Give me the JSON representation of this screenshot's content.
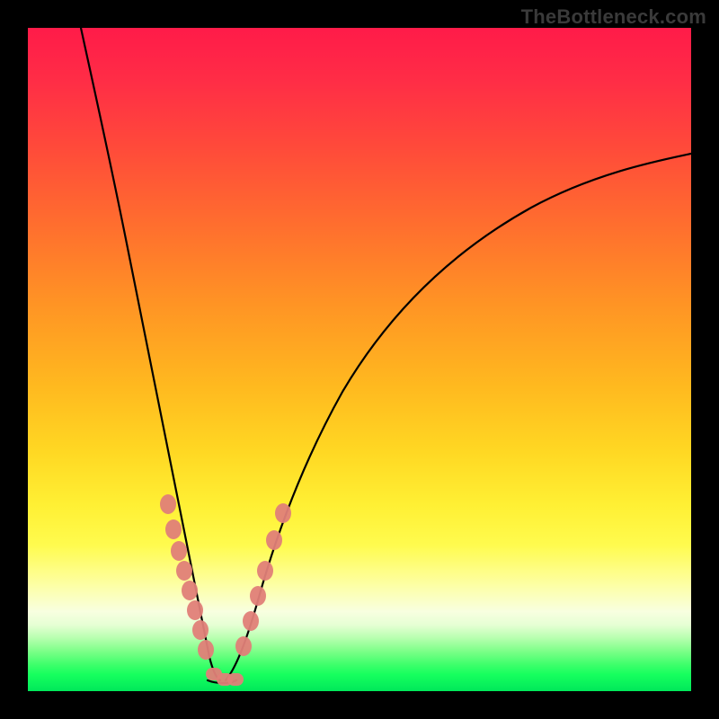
{
  "watermark": "TheBottleneck.com",
  "chart_data": {
    "type": "line",
    "title": "",
    "xlabel": "",
    "ylabel": "",
    "xlim": [
      0,
      100
    ],
    "ylim": [
      0,
      100
    ],
    "grid": false,
    "background_gradient": {
      "top": "#ff1b49",
      "bottom": "#00e85a",
      "description": "red→orange→yellow→green vertical gradient; green band at bottom ≈ 0–5%"
    },
    "series": [
      {
        "name": "left-curve",
        "description": "Left branch of V; steep descent from top-left toward trough",
        "x": [
          8,
          10,
          12,
          14,
          16,
          18,
          20,
          22,
          23,
          24,
          25,
          26,
          27,
          28
        ],
        "y": [
          100,
          90,
          79,
          67,
          55,
          44,
          33,
          22,
          17,
          12,
          8,
          5,
          3,
          2
        ]
      },
      {
        "name": "right-curve",
        "description": "Right branch of V; rises from trough, concave, tapering toward upper right",
        "x": [
          30,
          31,
          33,
          35,
          38,
          42,
          47,
          53,
          60,
          68,
          77,
          87,
          100
        ],
        "y": [
          2,
          4,
          9,
          16,
          25,
          36,
          47,
          56,
          63,
          69,
          74,
          78,
          81
        ]
      },
      {
        "name": "trough",
        "description": "Near-flat bottom of V",
        "x": [
          27,
          28,
          29,
          30,
          31
        ],
        "y": [
          2,
          1.5,
          1.5,
          1.5,
          2
        ]
      }
    ],
    "markers": {
      "description": "Salmon-pink rounded markers clustered on lower portions of both branches and along trough",
      "color": "#e08078",
      "points": [
        {
          "branch": "left",
          "x": 21.0,
          "y": 28
        },
        {
          "branch": "left",
          "x": 21.8,
          "y": 24
        },
        {
          "branch": "left",
          "x": 22.5,
          "y": 21
        },
        {
          "branch": "left",
          "x": 23.2,
          "y": 18
        },
        {
          "branch": "left",
          "x": 23.8,
          "y": 15
        },
        {
          "branch": "left",
          "x": 24.5,
          "y": 12
        },
        {
          "branch": "left",
          "x": 25.3,
          "y": 9
        },
        {
          "branch": "left",
          "x": 26.0,
          "y": 6.5
        },
        {
          "branch": "trough",
          "x": 27.0,
          "y": 3.0
        },
        {
          "branch": "trough",
          "x": 28.0,
          "y": 2.0
        },
        {
          "branch": "trough",
          "x": 29.0,
          "y": 1.8
        },
        {
          "branch": "trough",
          "x": 30.0,
          "y": 1.8
        },
        {
          "branch": "trough",
          "x": 31.0,
          "y": 2.2
        },
        {
          "branch": "right",
          "x": 32.5,
          "y": 7
        },
        {
          "branch": "right",
          "x": 33.5,
          "y": 11
        },
        {
          "branch": "right",
          "x": 34.5,
          "y": 15
        },
        {
          "branch": "right",
          "x": 35.5,
          "y": 18
        },
        {
          "branch": "right",
          "x": 37.0,
          "y": 23
        },
        {
          "branch": "right",
          "x": 38.5,
          "y": 27
        }
      ]
    }
  }
}
